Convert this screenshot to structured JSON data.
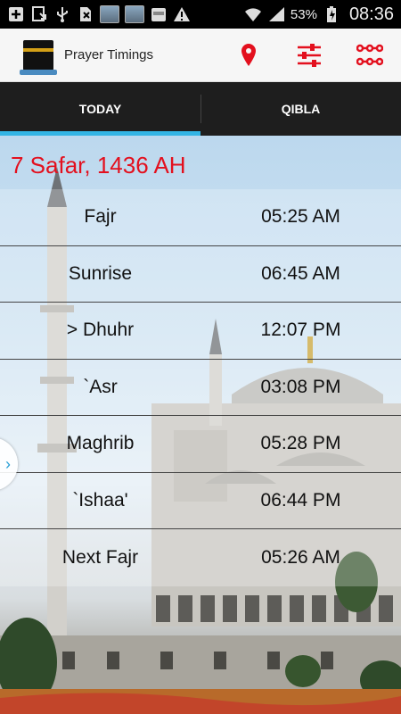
{
  "status_bar": {
    "icons": [
      "add-box-icon",
      "download-icon",
      "usb-icon",
      "no-sim-icon",
      "app-thumbnail",
      "app-thumbnail",
      "calendar-app-icon",
      "warning-icon"
    ],
    "battery_percent": "53%",
    "time": "08:36"
  },
  "header": {
    "title": "Prayer Timings",
    "accent_color": "#e3101e"
  },
  "tabs": [
    {
      "label": "TODAY",
      "active": true
    },
    {
      "label": "QIBLA",
      "active": false
    }
  ],
  "hijri_date": "7 Safar, 1436 AH",
  "prayers": [
    {
      "name": "Fajr",
      "time": "05:25 AM"
    },
    {
      "name": "Sunrise",
      "time": "06:45 AM"
    },
    {
      "name": "> Dhuhr",
      "time": "12:07 PM"
    },
    {
      "name": "`Asr",
      "time": "03:08 PM"
    },
    {
      "name": "Maghrib",
      "time": "05:28 PM"
    },
    {
      "name": "`Ishaa'",
      "time": "06:44 PM"
    },
    {
      "name": "Next Fajr",
      "time": "05:26 AM"
    }
  ],
  "side_handle_glyph": "›"
}
